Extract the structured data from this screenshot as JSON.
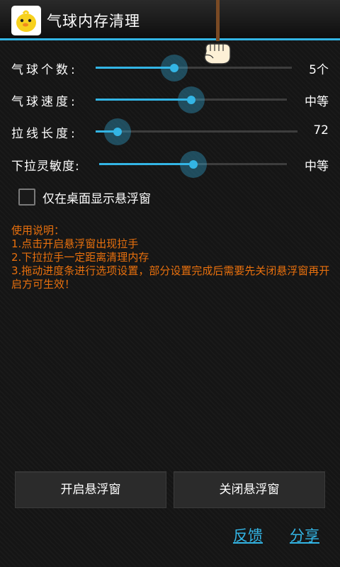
{
  "app": {
    "title": "气球内存清理",
    "icon": "chick-app-icon",
    "accent_color": "#33b5e5",
    "instruction_color": "#e8700d"
  },
  "sliders": [
    {
      "label": "气球个数:",
      "value": "5个",
      "level": 0.4
    },
    {
      "label": "气球速度:",
      "value": "中等",
      "level": 0.5
    },
    {
      "label": "拉线长度:",
      "value": "72",
      "level": 0.11
    },
    {
      "label": "下拉灵敏度:",
      "value": "中等",
      "level": 0.5
    }
  ],
  "options": {
    "desktop_only_label": "仅在桌面显示悬浮窗",
    "desktop_only_checked": false
  },
  "instructions": {
    "title": "使用说明：",
    "lines": [
      "1.点击开启悬浮窗出现拉手",
      "2.下拉拉手一定距离清理内存",
      "3.拖动进度条进行选项设置，部分设置完成后需要先关闭悬浮窗再开启方可生效！"
    ]
  },
  "buttons": {
    "open_float": "开启悬浮窗",
    "close_float": "关闭悬浮窗"
  },
  "links": {
    "feedback": "反馈",
    "share": "分享"
  }
}
